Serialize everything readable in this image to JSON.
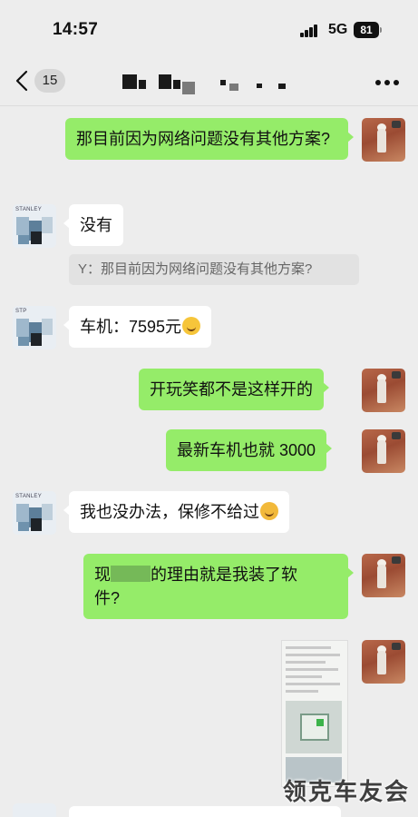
{
  "status_bar": {
    "time": "14:57",
    "network": "5G",
    "battery": "81"
  },
  "nav": {
    "unread_count": "15",
    "title": ""
  },
  "messages": [
    {
      "id": 1,
      "side": "me",
      "text": "那目前因为网络问题没有其他方案?"
    },
    {
      "id": 2,
      "side": "other",
      "text": "没有",
      "quote": "Y：那目前因为网络问题没有其他方案?"
    },
    {
      "id": 3,
      "side": "other",
      "text": "车机：7595元",
      "emoji": "laughing-tears"
    },
    {
      "id": 4,
      "side": "me",
      "text": "开玩笑都不是这样开的"
    },
    {
      "id": 5,
      "side": "me",
      "text": "最新车机也就 3000"
    },
    {
      "id": 6,
      "side": "other",
      "text": "我也没办法，保修不给过",
      "emoji": "tired-face"
    },
    {
      "id": 7,
      "side": "me",
      "text_before": "现",
      "text_after": "的理由就是我装了软",
      "text_line2": "件?"
    },
    {
      "id": 8,
      "side": "me",
      "type": "image"
    }
  ],
  "watermark": "领克车友会",
  "colors": {
    "me_bubble": "#95ec69",
    "other_bubble": "#ffffff",
    "background": "#ededed"
  }
}
